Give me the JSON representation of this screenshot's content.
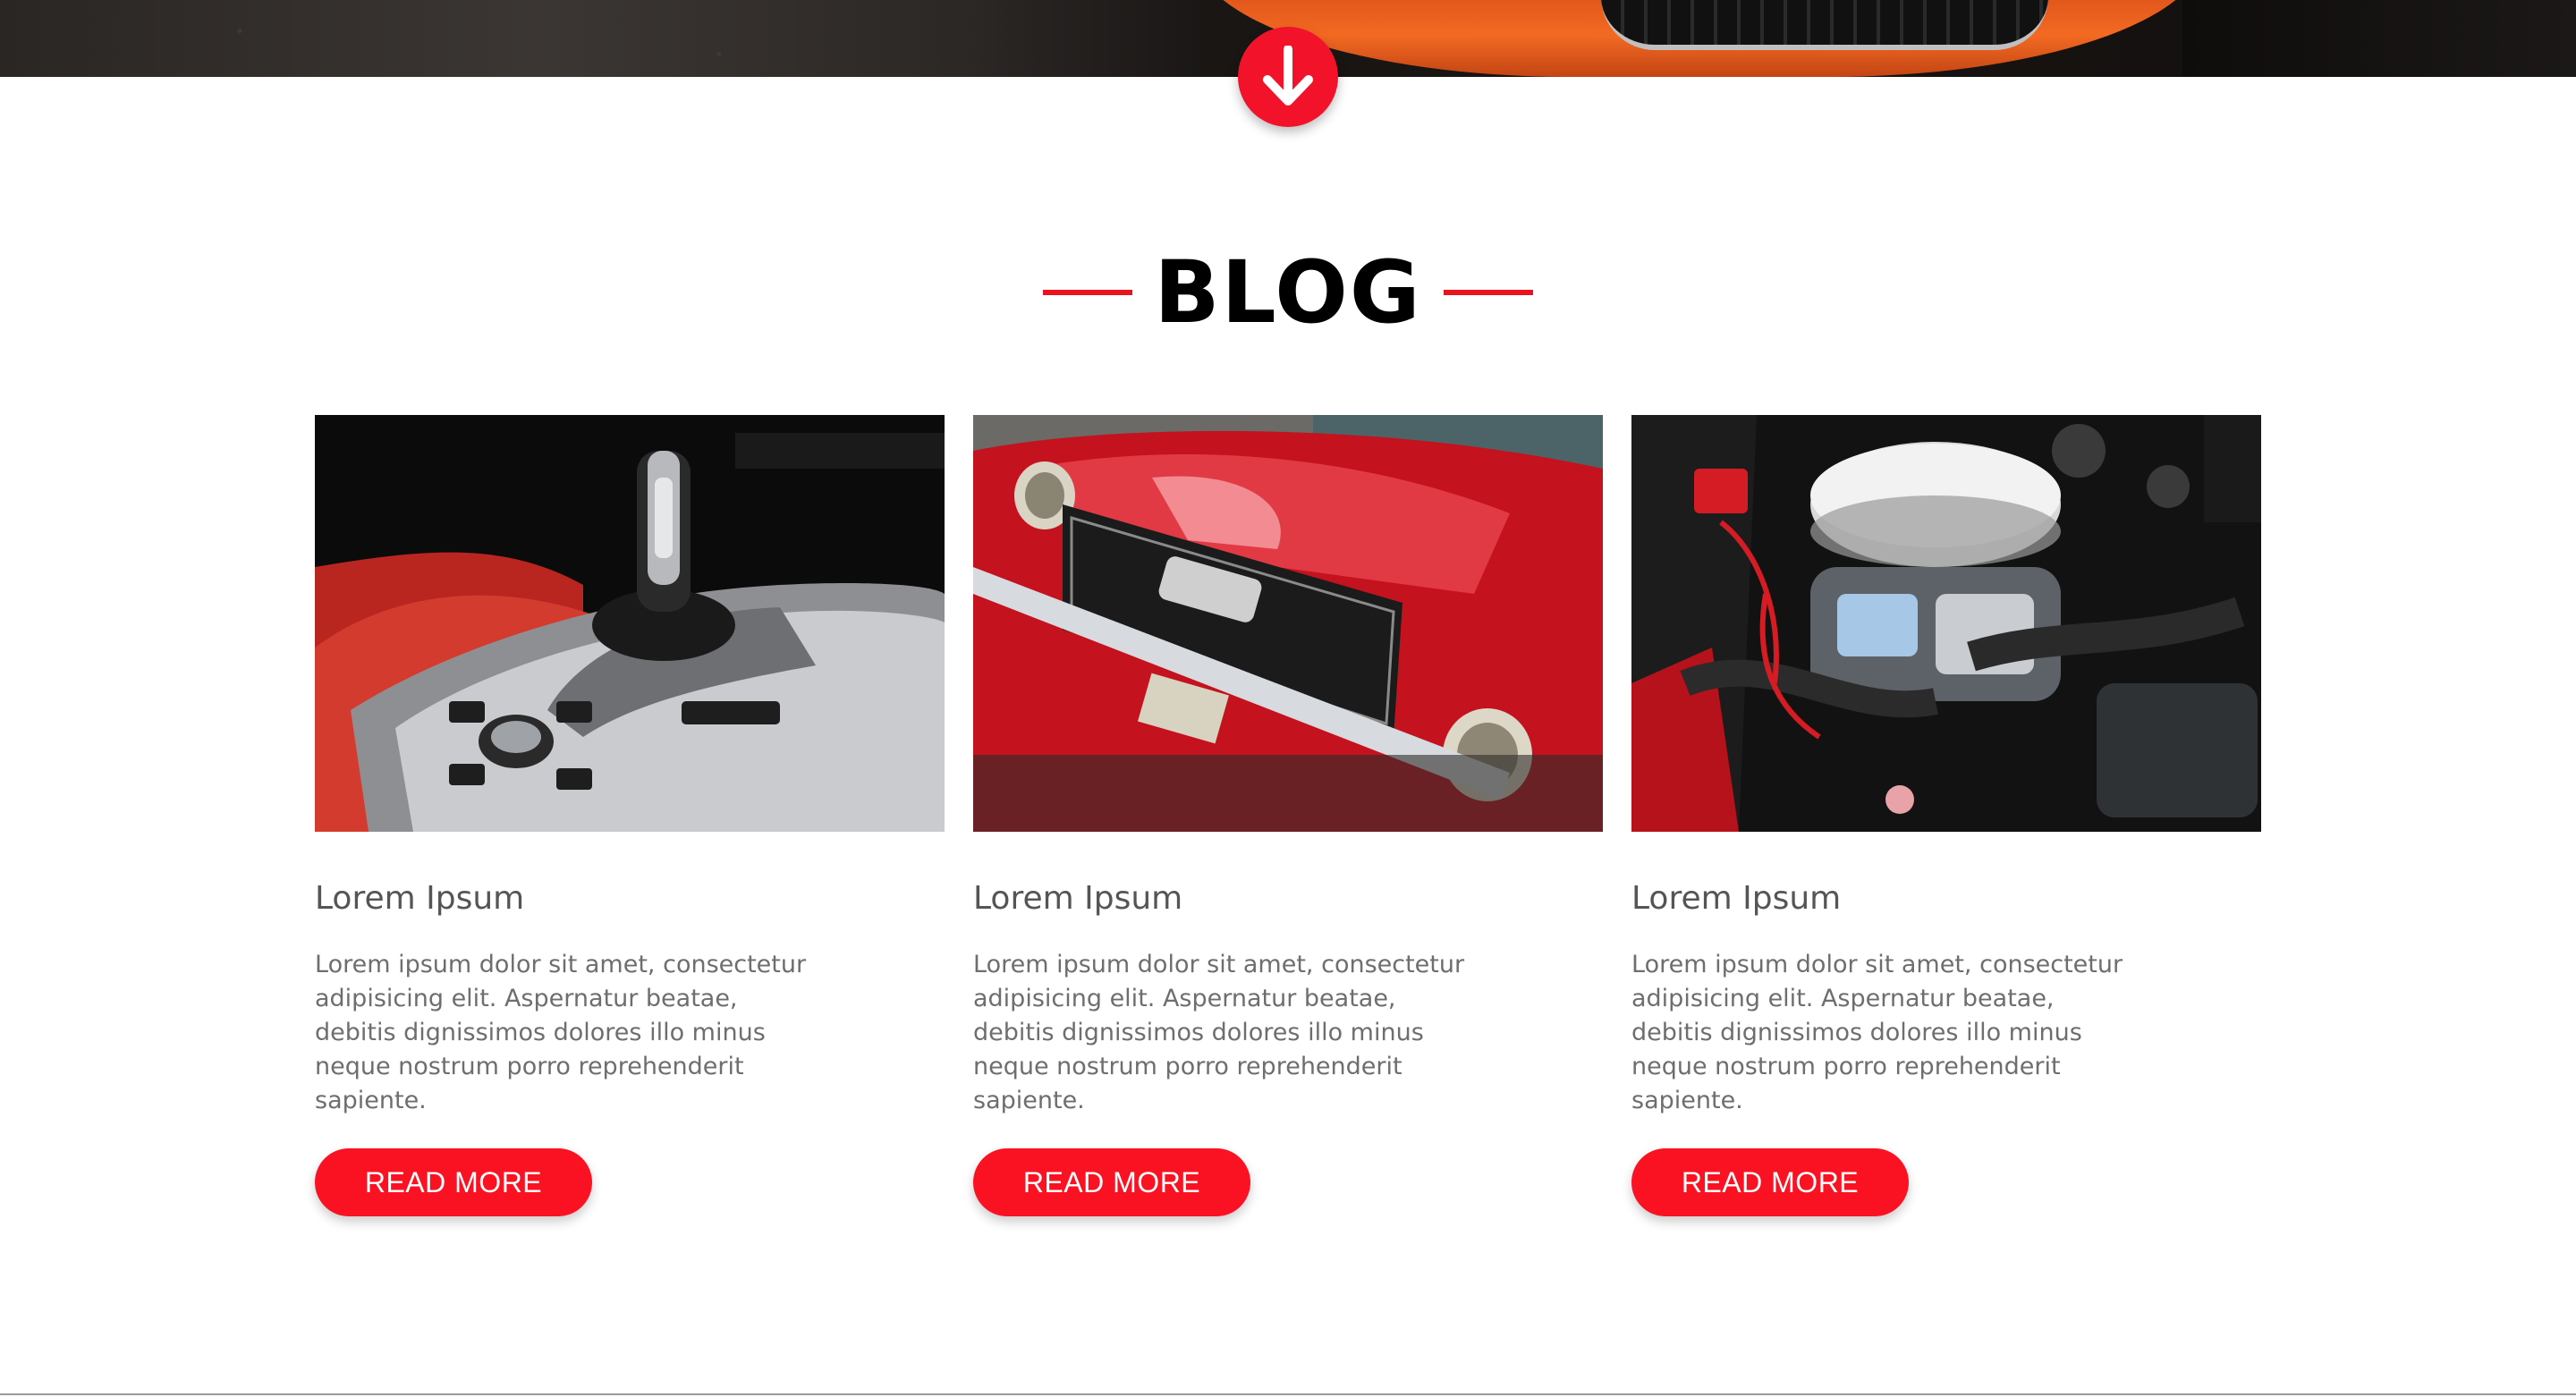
{
  "section": {
    "title": "BLOG"
  },
  "posts": [
    {
      "image": "car-interior-gear-shifter",
      "title": "Lorem Ipsum",
      "excerpt": "Lorem ipsum dolor sit amet, consectetur adipisicing elit. Aspernatur beatae, debitis dignissimos dolores illo minus neque nostrum porro reprehenderit sapiente.",
      "button_label": "READ MORE"
    },
    {
      "image": "red-classic-car-front",
      "title": "Lorem Ipsum",
      "excerpt": "Lorem ipsum dolor sit amet, consectetur adipisicing elit. Aspernatur beatae, debitis dignissimos dolores illo minus neque nostrum porro reprehenderit sapiente.",
      "button_label": "READ MORE"
    },
    {
      "image": "car-engine-bay",
      "title": "Lorem Ipsum",
      "excerpt": "Lorem ipsum dolor sit amet, consectetur adipisicing elit. Aspernatur beatae, debitis dignissimos dolores illo minus neque nostrum porro reprehenderit sapiente.",
      "button_label": "READ MORE"
    }
  ],
  "icons": {
    "scroll": "arrow-down-icon"
  },
  "colors": {
    "accent": "#fa1223",
    "heading": "#000000",
    "card_title": "#555555",
    "card_text": "#6e6e6e"
  }
}
